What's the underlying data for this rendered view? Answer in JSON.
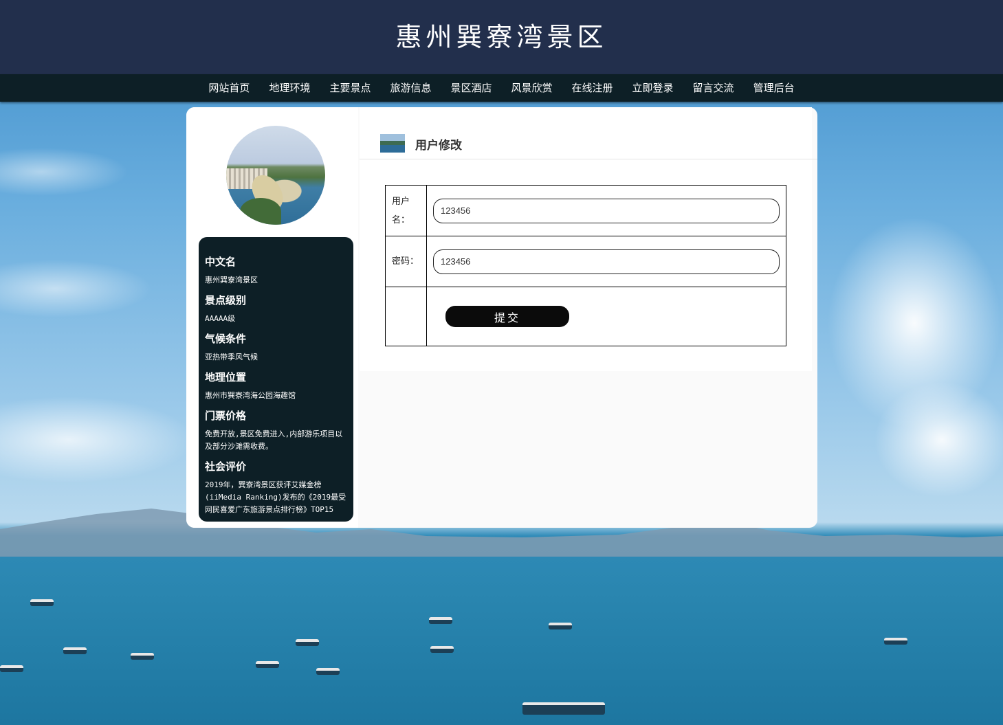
{
  "site": {
    "title": "惠州巽寮湾景区"
  },
  "nav": {
    "items": [
      {
        "label": "网站首页"
      },
      {
        "label": "地理环境"
      },
      {
        "label": "主要景点"
      },
      {
        "label": "旅游信息"
      },
      {
        "label": "景区酒店"
      },
      {
        "label": "风景欣赏"
      },
      {
        "label": "在线注册"
      },
      {
        "label": "立即登录"
      },
      {
        "label": "留言交流"
      },
      {
        "label": "管理后台"
      }
    ]
  },
  "sidebar": {
    "sections": [
      {
        "heading": "中文名",
        "text": "惠州巽寮湾景区"
      },
      {
        "heading": "景点级别",
        "text": "AAAAA级"
      },
      {
        "heading": "气候条件",
        "text": "亚热带季风气候"
      },
      {
        "heading": "地理位置",
        "text": "惠州市巽寮湾海公园海趣馆"
      },
      {
        "heading": "门票价格",
        "text": "免费开放,景区免费进入,内部游乐项目以及部分沙滩需收费。"
      },
      {
        "heading": "社会评价",
        "text": "2019年，巽寮湾景区获评艾媒金榜(iiMedia Ranking)发布的《2019最受网民喜爱广东旅游景点排行榜》TOP15"
      }
    ]
  },
  "main": {
    "title": "用户修改",
    "form": {
      "username_label": "用户名：",
      "username_value": "123456",
      "password_label": "密码：",
      "password_value": "123456",
      "submit_label": "提交"
    }
  },
  "colors": {
    "header_bg": "#222f4c",
    "nav_bg": "#0d1f26",
    "panel_bg": "#0d1f26",
    "button_bg": "#0b0b0b"
  }
}
